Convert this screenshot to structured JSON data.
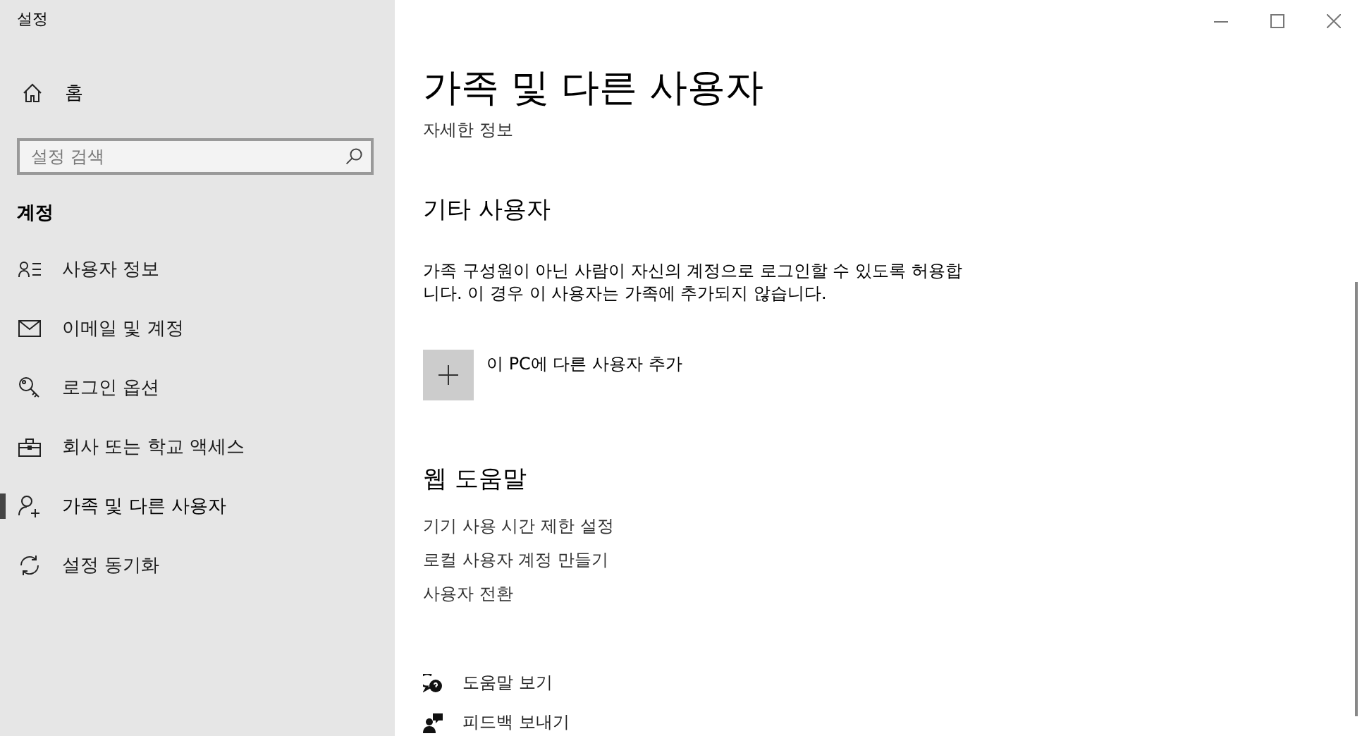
{
  "window": {
    "title": "설정"
  },
  "sidebar": {
    "home": "홈",
    "search": {
      "placeholder": "설정 검색"
    },
    "section": "계정",
    "items": [
      {
        "label": "사용자 정보",
        "selected": false
      },
      {
        "label": "이메일 및 계정",
        "selected": false
      },
      {
        "label": "로그인 옵션",
        "selected": false
      },
      {
        "label": "회사 또는 학교 액세스",
        "selected": false
      },
      {
        "label": "가족 및 다른 사용자",
        "selected": true
      },
      {
        "label": "설정 동기화",
        "selected": false
      }
    ]
  },
  "main": {
    "title": "가족 및 다른 사용자",
    "subtitle": "자세한 정보",
    "other_users": {
      "heading": "기타 사용자",
      "description": "가족 구성원이 아닌 사람이 자신의 계정으로 로그인할 수 있도록 허용합니다. 이 경우 이 사용자는 가족에 추가되지 않습니다.",
      "add_button": "이 PC에 다른 사용자 추가"
    },
    "web_help": {
      "heading": "웹 도움말",
      "links": [
        "기기 사용 시간 제한 설정",
        "로컬 사용자 계정 만들기",
        "사용자 전환"
      ]
    },
    "footer": [
      {
        "kind": "help",
        "label": "도움말 보기"
      },
      {
        "kind": "feedback",
        "label": "피드백 보내기"
      }
    ]
  }
}
